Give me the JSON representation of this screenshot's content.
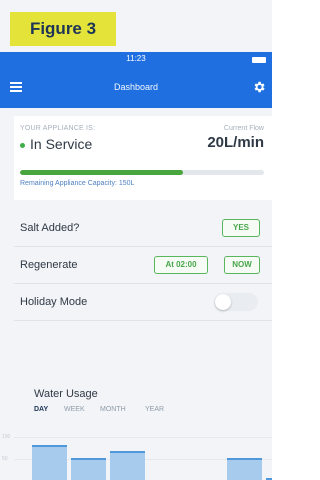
{
  "figure": {
    "label": "Figure 3"
  },
  "status_bar": {
    "time": "11:23"
  },
  "header": {
    "title": "Dashboard"
  },
  "appliance": {
    "label": "YOUR APPLIANCE IS:",
    "status": "In Service",
    "flow_label": "Current Flow",
    "flow_value": "20L/min",
    "capacity_label": "Remaining Appliance Capacity: 150L",
    "capacity_fraction": 0.67
  },
  "rows": {
    "salt": {
      "label": "Salt Added?",
      "yes": "YES"
    },
    "regenerate": {
      "label": "Regenerate",
      "scheduled": "At 02:00",
      "now": "NOW"
    },
    "holiday": {
      "label": "Holiday Mode",
      "enabled": false
    }
  },
  "usage": {
    "title": "Water Usage",
    "tabs": [
      "DAY",
      "WEEK",
      "MONTH",
      "YEAR"
    ],
    "active_tab": "DAY"
  },
  "chart_data": {
    "type": "bar",
    "title": "Water Usage",
    "y_tick_labels": [
      "100",
      "50"
    ],
    "values": [
      0.8,
      0.5,
      0.65,
      0,
      0,
      0.5,
      0.05,
      0.7
    ]
  },
  "colors": {
    "header_blue": "#1f6fe0",
    "accent_green": "#47a649",
    "bar_fill": "#a7cbec",
    "figure_label_bg": "#e3e33a"
  },
  "icons": [
    "menu-icon",
    "gear-icon",
    "battery-icon",
    "status-dot-icon"
  ]
}
